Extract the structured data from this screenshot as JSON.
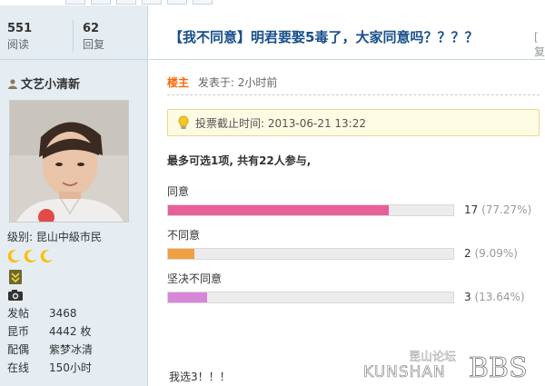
{
  "stats": {
    "views": {
      "value": "551",
      "label": "阅读"
    },
    "replies": {
      "value": "62",
      "label": "回复"
    }
  },
  "author": {
    "name": "文艺小清新",
    "level_label": "级别:",
    "level_name": "昆山中級市民",
    "info": [
      {
        "key": "发帖",
        "value": "3468"
      },
      {
        "key": "昆币",
        "value": "4442 枚"
      },
      {
        "key": "配偶",
        "value": "紫梦冰清"
      },
      {
        "key": "在线",
        "value": "150小时"
      }
    ]
  },
  "thread": {
    "title": "【我不同意】明君要娶5毒了，大家同意吗？？？？",
    "title_right": "[ 复"
  },
  "post": {
    "floor_label": "楼主",
    "posted_at": "发表于: 2小时前"
  },
  "poll": {
    "deadline": "投票截止时间: 2013-06-21 13:22",
    "summary": "最多可选1项, 共有22人参与,",
    "options": [
      {
        "label": "同意",
        "count": "17",
        "percent_text": "(77.27%)",
        "fraction": 0.7727,
        "color": "#e8609a"
      },
      {
        "label": "不同意",
        "count": "2",
        "percent_text": "(9.09%)",
        "fraction": 0.0909,
        "color": "#f0a040"
      },
      {
        "label": "坚决不同意",
        "count": "3",
        "percent_text": "(13.64%)",
        "fraction": 0.1364,
        "color": "#d787d8"
      }
    ]
  },
  "reply": {
    "text": "我选3！！！"
  },
  "watermark": {
    "site_cn": "昆山论坛",
    "site_en": "KUNSHAN",
    "bbs": "BBS"
  }
}
